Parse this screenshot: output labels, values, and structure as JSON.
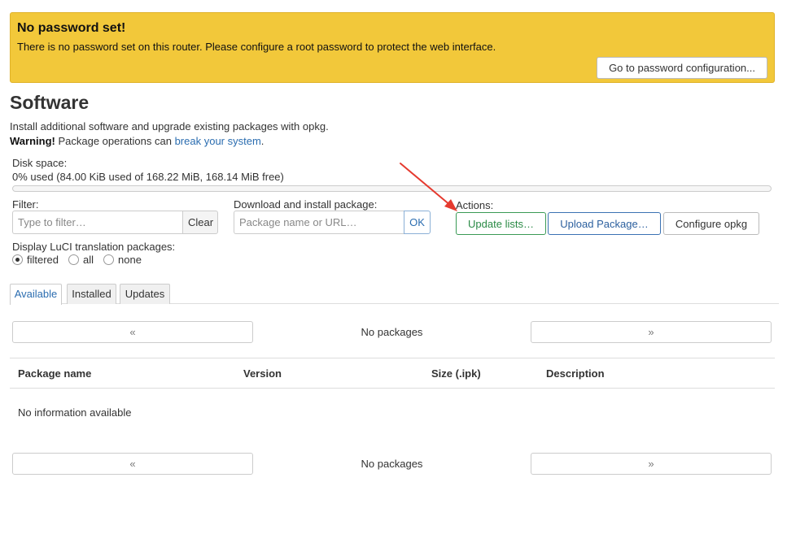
{
  "alert": {
    "title": "No password set!",
    "message": "There is no password set on this router. Please configure a root password to protect the web interface.",
    "button": "Go to password configuration..."
  },
  "page": {
    "title": "Software",
    "description": "Install additional software and upgrade existing packages with opkg.",
    "warning_label": "Warning!",
    "warning_text": "Package operations can",
    "warning_link": "break your system",
    "warning_end": "."
  },
  "disk": {
    "label": "Disk space:",
    "value": "0% used (84.00 KiB used of 168.22 MiB, 168.14 MiB free)",
    "used_percent": 0
  },
  "filter": {
    "label": "Filter:",
    "placeholder": "Type to filter…",
    "clear": "Clear"
  },
  "install": {
    "label": "Download and install package:",
    "placeholder": "Package name or URL…",
    "ok": "OK"
  },
  "actions": {
    "label": "Actions:",
    "update": "Update lists…",
    "upload": "Upload Package…",
    "configure": "Configure opkg"
  },
  "translation": {
    "label": "Display LuCI translation packages:",
    "options": [
      "filtered",
      "all",
      "none"
    ],
    "selected": "filtered"
  },
  "tabs": [
    "Available",
    "Installed",
    "Updates"
  ],
  "pager": {
    "prev": "«",
    "next": "»",
    "status": "No packages"
  },
  "table": {
    "columns": [
      "Package name",
      "Version",
      "Size (.ipk)",
      "Description"
    ],
    "empty": "No information available"
  },
  "colors": {
    "alert_bg": "#f2c83a",
    "link": "#2b6db0",
    "update_btn": "#2a8a45",
    "annotation_arrow": "#e53a2f"
  }
}
